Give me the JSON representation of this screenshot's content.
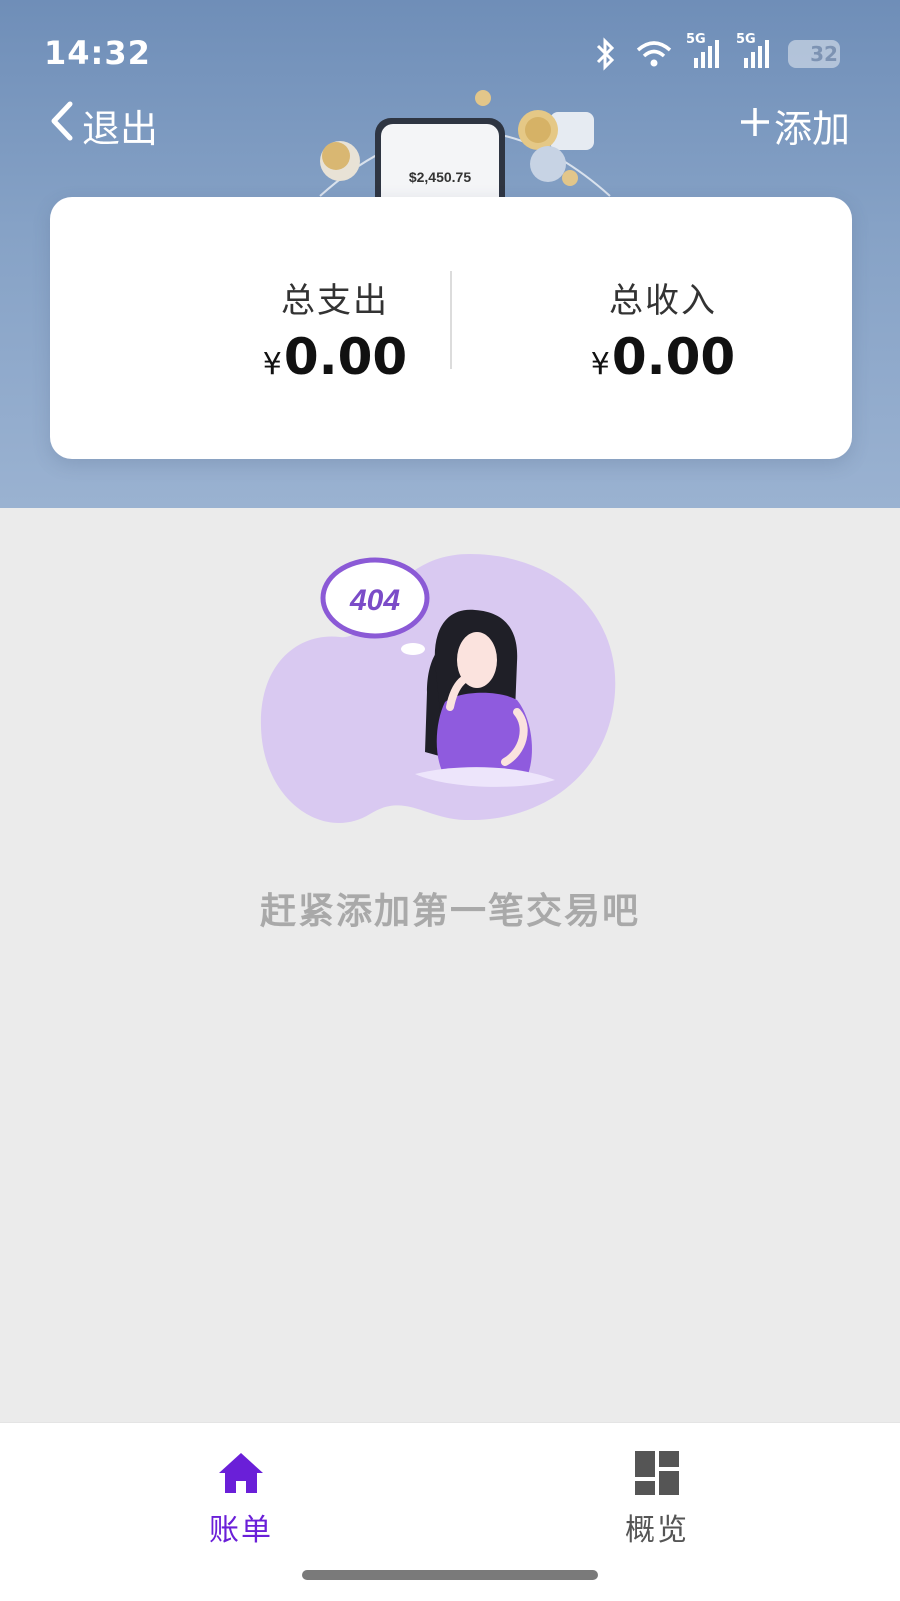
{
  "status_bar": {
    "time": "14:32",
    "battery": "32",
    "network_1": "5G",
    "network_2": "5G",
    "icons": [
      "bluetooth-icon",
      "wifi-icon",
      "signal-icon",
      "signal-icon",
      "battery-icon"
    ]
  },
  "nav": {
    "back_label": "退出",
    "add_label": "添加",
    "back_icon": "chevron-left-icon",
    "add_icon": "plus-icon"
  },
  "banner": {
    "phone_amount": "$2,450.75"
  },
  "summary": {
    "expense_label": "总支出",
    "expense_currency": "¥",
    "expense_value": "0.00",
    "income_label": "总收入",
    "income_currency": "¥",
    "income_value": "0.00"
  },
  "empty_state": {
    "badge": "404",
    "message": "赶紧添加第一笔交易吧"
  },
  "tabbar": {
    "tabs": [
      {
        "label": "账单",
        "icon": "home-icon",
        "active": true
      },
      {
        "label": "概览",
        "icon": "dashboard-icon",
        "active": false
      }
    ],
    "active_color": "#6a1fd8",
    "inactive_color": "#555555"
  },
  "colors": {
    "header_bg": "#7b98bf",
    "accent": "#6a1fd8",
    "illustration_purple": "#9b6fe0"
  }
}
